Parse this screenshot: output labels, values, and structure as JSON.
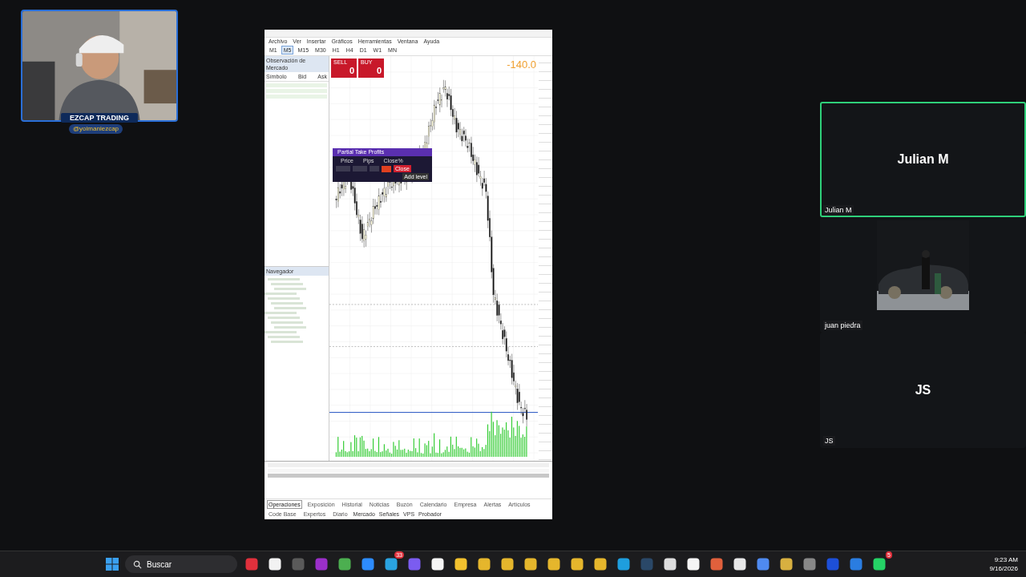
{
  "webcam": {
    "title": "EZCAP TRADING",
    "handle": "@yoimaniezcap"
  },
  "terminal": {
    "menu": [
      "Archivo",
      "Ver",
      "Insertar",
      "Gráficos",
      "Herramientas",
      "Ventana",
      "Ayuda"
    ],
    "timeframes": [
      {
        "label": "M1",
        "selected": false
      },
      {
        "label": "M5",
        "selected": true
      },
      {
        "label": "M15",
        "selected": false
      },
      {
        "label": "M30",
        "selected": false
      },
      {
        "label": "H1",
        "selected": false
      },
      {
        "label": "H4",
        "selected": false
      },
      {
        "label": "D1",
        "selected": false
      },
      {
        "label": "W1",
        "selected": false
      },
      {
        "label": "MN",
        "selected": false
      }
    ],
    "market_watch": {
      "title": "Observación de Mercado",
      "columns": [
        "Símbolo",
        "Bid",
        "Ask"
      ]
    },
    "navigator": {
      "title": "Navegador"
    },
    "trade_panel": {
      "sell": "SELL",
      "buy": "BUY",
      "sell_price": "0",
      "buy_price": "0",
      "profit": "-140.0"
    },
    "dialog": {
      "title": "Partial Take Profits",
      "columns": [
        "Price",
        "Pips",
        "Close%"
      ],
      "close": "Close",
      "add": "Add level"
    },
    "toolbox_tabs": [
      {
        "label": "Operaciones",
        "selected": true
      },
      {
        "label": "Exposición",
        "selected": false
      },
      {
        "label": "Historial",
        "selected": false
      },
      {
        "label": "Noticias",
        "selected": false
      },
      {
        "label": "Buzón",
        "selected": false
      },
      {
        "label": "Calendario",
        "selected": false
      },
      {
        "label": "Empresa",
        "selected": false
      },
      {
        "label": "Alertas",
        "selected": false
      },
      {
        "label": "Artículos",
        "selected": false
      },
      {
        "label": "Code Base",
        "selected": false
      },
      {
        "label": "Expertos",
        "selected": false
      },
      {
        "label": "Diario",
        "selected": false
      }
    ],
    "status": [
      "Mercado",
      "Señales",
      "VPS",
      "Probador"
    ]
  },
  "participants": [
    {
      "name": "Julian M",
      "kind": "initials",
      "display": "Julian M",
      "speaking": true
    },
    {
      "name": "juan piedra",
      "kind": "video",
      "speaking": false
    },
    {
      "name": "JS",
      "kind": "initials",
      "display": "JS",
      "speaking": false
    }
  ],
  "taskbar": {
    "search": "Buscar",
    "apps": [
      {
        "color": "#e0303c"
      },
      {
        "color": "#f2f2f2"
      },
      {
        "color": "#5a5a5a"
      },
      {
        "color": "#9b2fc9"
      },
      {
        "color": "#4caf50"
      },
      {
        "color": "#2d8cff"
      },
      {
        "color": "#2aa3e0",
        "badge": "33"
      },
      {
        "color": "#7b5cf0"
      },
      {
        "color": "#f5f5f5"
      },
      {
        "color": "#f2c12e"
      },
      {
        "color": "#e5b62c"
      },
      {
        "color": "#e5b62c"
      },
      {
        "color": "#e5b62c"
      },
      {
        "color": "#e5b62c"
      },
      {
        "color": "#e5b62c"
      },
      {
        "color": "#e5b62c"
      },
      {
        "color": "#1e9ede"
      },
      {
        "color": "#2a4868"
      },
      {
        "color": "#dddddd"
      },
      {
        "color": "#f5f5f5"
      },
      {
        "color": "#e0603c"
      },
      {
        "color": "#e8e8e8"
      },
      {
        "color": "#4f8af0"
      },
      {
        "color": "#d8b040"
      },
      {
        "color": "#888888"
      },
      {
        "color": "#1d4fd8"
      },
      {
        "color": "#2a7de1"
      },
      {
        "color": "#25d366",
        "badge": "5"
      }
    ],
    "time": "9:23 AM",
    "date": "9/16/2026"
  }
}
